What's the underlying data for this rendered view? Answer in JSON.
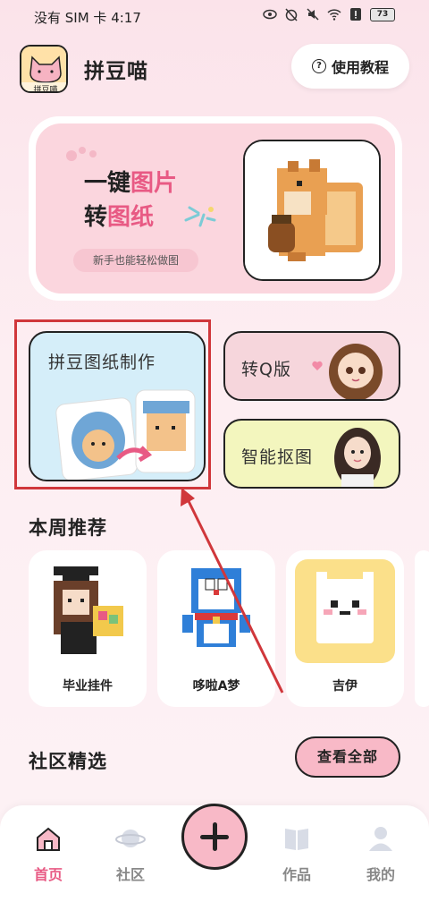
{
  "status_bar": {
    "left_text": "没有 SIM 卡 4:17",
    "battery": "73"
  },
  "header": {
    "app_title": "拼豆喵",
    "logo_text": "拼豆喵",
    "tutorial_label": "使用教程"
  },
  "banner": {
    "line1_prefix": "一键",
    "line1_highlight": "图片",
    "line2_prefix": "转",
    "line2_highlight": "图纸",
    "pill": "新手也能轻松做图"
  },
  "features": {
    "make_label": "拼豆图纸制作",
    "q_label": "转Q版",
    "cutout_label": "智能抠图"
  },
  "weekly": {
    "title": "本周推荐",
    "items": [
      {
        "label": "毕业挂件"
      },
      {
        "label": "哆啦A梦"
      },
      {
        "label": "吉伊"
      }
    ]
  },
  "community": {
    "title": "社区精选",
    "view_all": "查看全部"
  },
  "nav": {
    "items": [
      {
        "label": "首页"
      },
      {
        "label": "社区"
      },
      {
        "label": "作品"
      },
      {
        "label": "我的"
      }
    ],
    "active_color": "#e85a84"
  },
  "colors": {
    "accent": "#e85a84",
    "highlight_frame": "#d0373b",
    "pink_btn": "#f8b9c7"
  }
}
